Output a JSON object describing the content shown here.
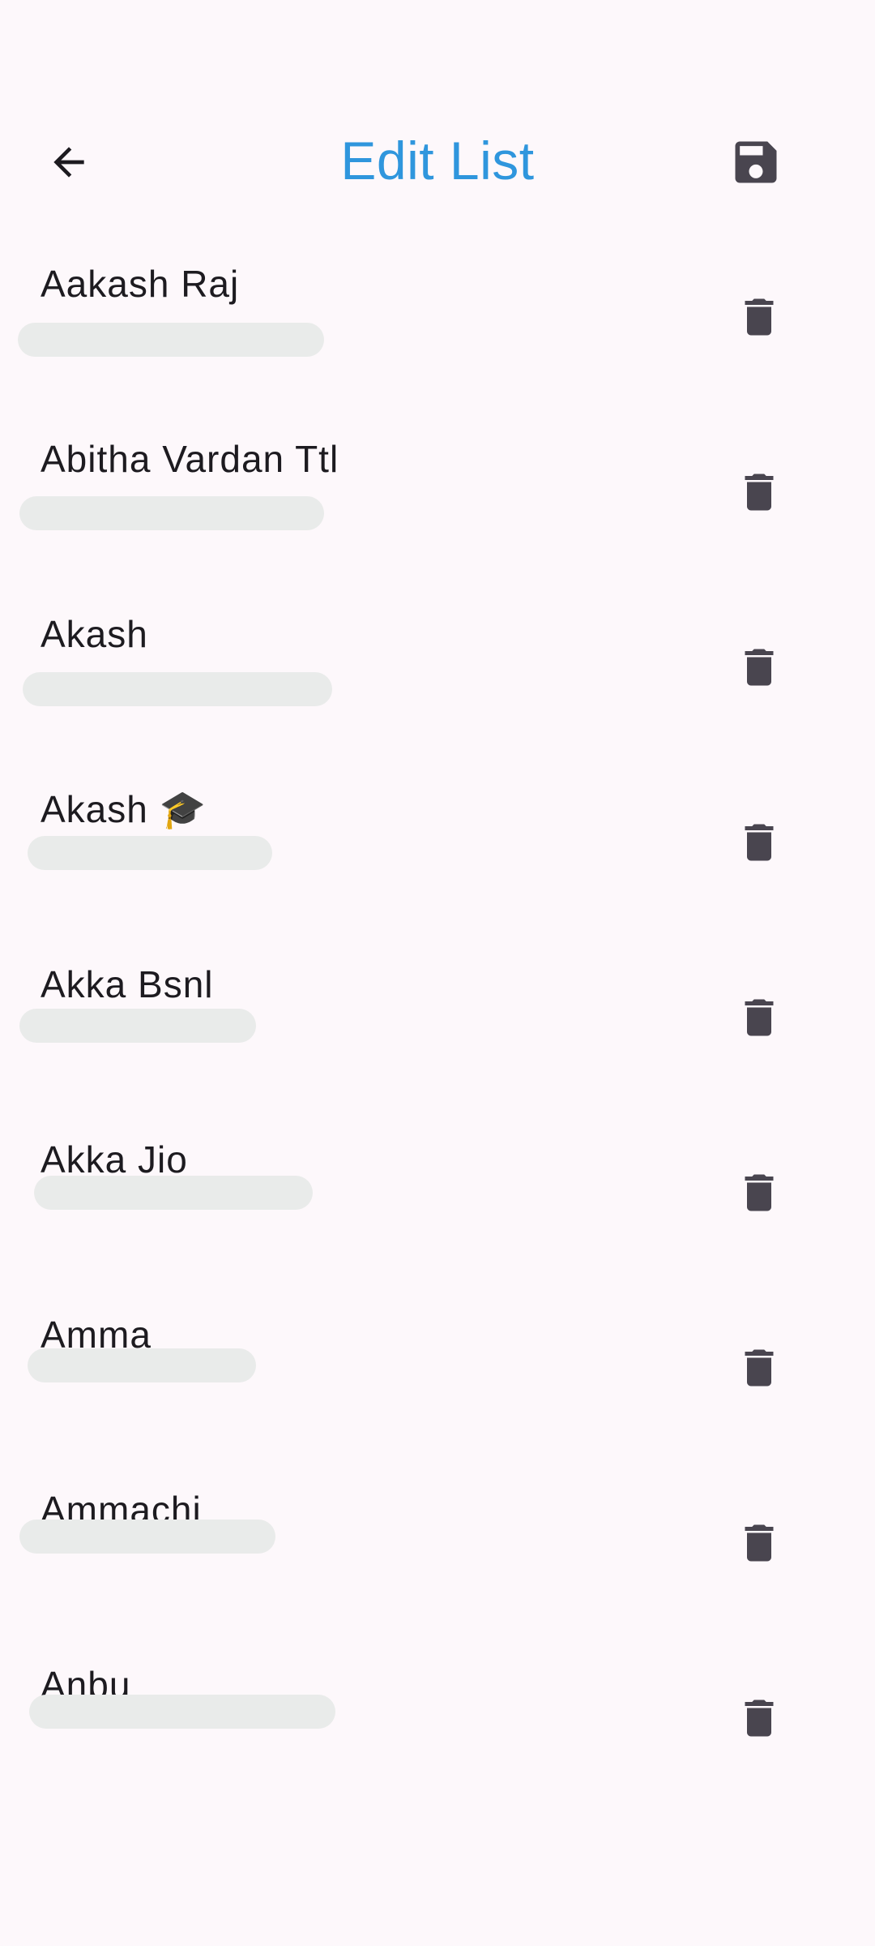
{
  "app_bar": {
    "title": "Edit List",
    "back_icon": "arrow-back-icon",
    "save_icon": "save-icon"
  },
  "contacts": [
    {
      "name": "Aakash Raj"
    },
    {
      "name": "Abitha Vardan Ttl"
    },
    {
      "name": "Akash"
    },
    {
      "name": "Akash 🎓"
    },
    {
      "name": "Akka Bsnl"
    },
    {
      "name": "Akka Jio"
    },
    {
      "name": "Amma"
    },
    {
      "name": "Ammachi"
    },
    {
      "name": "Anbu"
    }
  ],
  "colors": {
    "title": "#2f96dd",
    "icon": "#49454f",
    "background": "#fdf8fb",
    "redaction": "#e9ebea"
  }
}
